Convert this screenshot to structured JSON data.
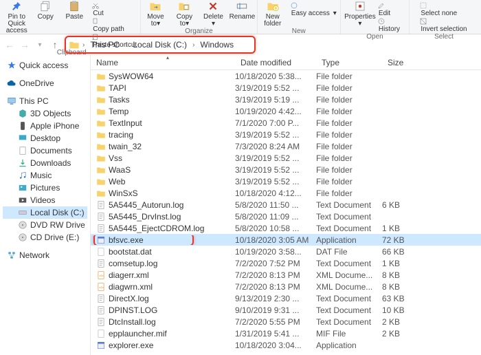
{
  "ribbon": {
    "pin": {
      "l1": "Pin to Quick",
      "l2": "access"
    },
    "copy": "Copy",
    "paste": "Paste",
    "mini1": [
      "Cut",
      "Copy path",
      "Paste shortcut"
    ],
    "moveto": {
      "l1": "Move",
      "l2": "to"
    },
    "copyto": {
      "l1": "Copy",
      "l2": "to"
    },
    "delete": "Delete",
    "rename": "Rename",
    "newfolder": {
      "l1": "New",
      "l2": "folder"
    },
    "properties": "Properties",
    "mini2": [
      "Easy access",
      "Edit",
      "History"
    ],
    "mini3": [
      "Select none",
      "Invert selection"
    ],
    "caps": {
      "clipboard": "Clipboard",
      "organize": "Organize",
      "new": "New",
      "open": "Open",
      "select": "Select"
    }
  },
  "breadcrumb": {
    "thispc": "This PC",
    "drive": "Local Disk (C:)",
    "folder": "Windows"
  },
  "tree": {
    "quick": "Quick access",
    "onedrive": "OneDrive",
    "thispc": "This PC",
    "objects": "3D Objects",
    "iphone": "Apple iPhone",
    "desktop": "Desktop",
    "documents": "Documents",
    "downloads": "Downloads",
    "music": "Music",
    "pictures": "Pictures",
    "videos": "Videos",
    "cdrive": "Local Disk (C:)",
    "dvd": "DVD RW Drive",
    "cddrive": "CD Drive (E:)",
    "network": "Network"
  },
  "columns": {
    "name": "Name",
    "date": "Date modified",
    "type": "Type",
    "size": "Size"
  },
  "files": [
    {
      "n": "SysWOW64",
      "d": "10/18/2020 5:38...",
      "t": "File folder",
      "s": "",
      "k": "folder"
    },
    {
      "n": "TAPI",
      "d": "3/19/2019 5:52 ...",
      "t": "File folder",
      "s": "",
      "k": "folder"
    },
    {
      "n": "Tasks",
      "d": "3/19/2019 5:19 ...",
      "t": "File folder",
      "s": "",
      "k": "folder"
    },
    {
      "n": "Temp",
      "d": "10/19/2020 4:42...",
      "t": "File folder",
      "s": "",
      "k": "folder"
    },
    {
      "n": "TextInput",
      "d": "7/1/2020 7:00 P...",
      "t": "File folder",
      "s": "",
      "k": "folder"
    },
    {
      "n": "tracing",
      "d": "3/19/2019 5:52 ...",
      "t": "File folder",
      "s": "",
      "k": "folder"
    },
    {
      "n": "twain_32",
      "d": "7/3/2020 8:24 AM",
      "t": "File folder",
      "s": "",
      "k": "folder"
    },
    {
      "n": "Vss",
      "d": "3/19/2019 5:52 ...",
      "t": "File folder",
      "s": "",
      "k": "folder"
    },
    {
      "n": "WaaS",
      "d": "3/19/2019 5:52 ...",
      "t": "File folder",
      "s": "",
      "k": "folder"
    },
    {
      "n": "Web",
      "d": "3/19/2019 5:52 ...",
      "t": "File folder",
      "s": "",
      "k": "folder"
    },
    {
      "n": "WinSxS",
      "d": "10/18/2020 4:12...",
      "t": "File folder",
      "s": "",
      "k": "folder"
    },
    {
      "n": "5A5445_Autorun.log",
      "d": "5/8/2020 11:50 ...",
      "t": "Text Document",
      "s": "6 KB",
      "k": "txt"
    },
    {
      "n": "5A5445_DrvInst.log",
      "d": "5/8/2020 11:09 ...",
      "t": "Text Document",
      "s": "",
      "k": "txt"
    },
    {
      "n": "5A5445_EjectCDROM.log",
      "d": "5/8/2020 10:58 ...",
      "t": "Text Document",
      "s": "1 KB",
      "k": "txt"
    },
    {
      "n": "bfsvc.exe",
      "d": "10/18/2020 3:05 AM",
      "t": "Application",
      "s": "72 KB",
      "k": "exe",
      "hl": true,
      "sel": true
    },
    {
      "n": "bootstat.dat",
      "d": "10/19/2020 3:58...",
      "t": "DAT File",
      "s": "66 KB",
      "k": "dat"
    },
    {
      "n": "comsetup.log",
      "d": "7/2/2020 7:52 PM",
      "t": "Text Document",
      "s": "1 KB",
      "k": "txt"
    },
    {
      "n": "diagerr.xml",
      "d": "7/2/2020 8:13 PM",
      "t": "XML Docume...",
      "s": "8 KB",
      "k": "xml"
    },
    {
      "n": "diagwrn.xml",
      "d": "7/2/2020 8:13 PM",
      "t": "XML Docume...",
      "s": "8 KB",
      "k": "xml"
    },
    {
      "n": "DirectX.log",
      "d": "9/13/2019 2:30 ...",
      "t": "Text Document",
      "s": "63 KB",
      "k": "txt"
    },
    {
      "n": "DPINST.LOG",
      "d": "9/10/2019 9:31 ...",
      "t": "Text Document",
      "s": "10 KB",
      "k": "txt"
    },
    {
      "n": "DtcInstall.log",
      "d": "7/2/2020 5:55 PM",
      "t": "Text Document",
      "s": "2 KB",
      "k": "txt"
    },
    {
      "n": "epplauncher.mif",
      "d": "1/31/2019 5:41 ...",
      "t": "MIF File",
      "s": "2 KB",
      "k": "dat"
    },
    {
      "n": "explorer.exe",
      "d": "10/18/2020 3:04...",
      "t": "Application",
      "s": "",
      "k": "exe"
    }
  ]
}
